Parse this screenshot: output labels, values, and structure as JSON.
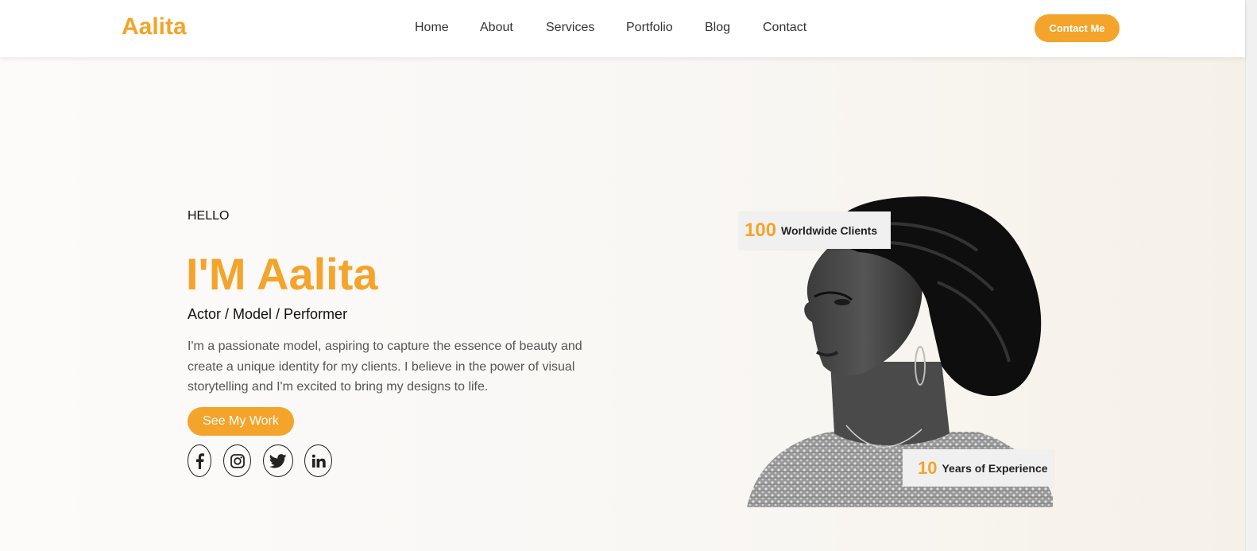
{
  "brand": {
    "logo": "Aalita",
    "accent_color": "#f4a42a"
  },
  "nav": {
    "items": [
      {
        "label": "Home"
      },
      {
        "label": "About"
      },
      {
        "label": "Services"
      },
      {
        "label": "Portfolio"
      },
      {
        "label": "Blog"
      },
      {
        "label": "Contact"
      }
    ],
    "cta_label": "Contact Me"
  },
  "hero": {
    "greeting": "HELLO",
    "title": "I'M Aalita",
    "subtitle": "Actor / Model / Performer",
    "description": "I'm a passionate model, aspiring to capture the essence of beauty and create a unique identity for my clients. I believe in the power of visual storytelling and I'm excited to bring my designs to life.",
    "cta_label": "See My Work",
    "socials": [
      {
        "icon": "facebook-icon"
      },
      {
        "icon": "instagram-icon"
      },
      {
        "icon": "twitter-icon"
      },
      {
        "icon": "linkedin-icon"
      }
    ]
  },
  "stats": [
    {
      "number": "100",
      "label": "Worldwide Clients"
    },
    {
      "number": "10",
      "label": "Years of Experience"
    }
  ]
}
